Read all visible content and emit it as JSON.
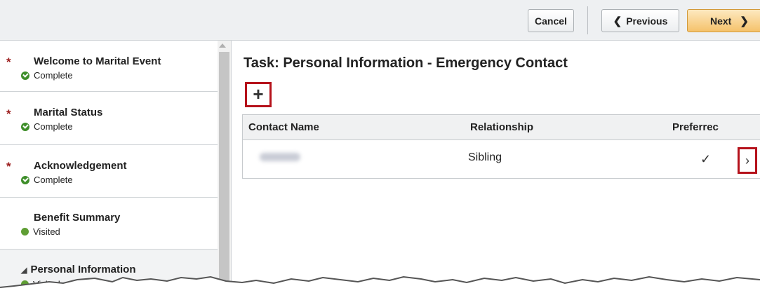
{
  "toolbar": {
    "cancel_label": "Cancel",
    "previous_label": "Previous",
    "previous_icon": "chevron-left-icon",
    "next_label": "Next",
    "next_icon": "chevron-right-icon",
    "next_accent": "#f5c26b"
  },
  "sidebar": {
    "steps": [
      {
        "title": "Welcome to Marital Event",
        "status": "Complete",
        "required": true,
        "status_icon": "check-circle-icon"
      },
      {
        "title": "Marital Status",
        "status": "Complete",
        "required": true,
        "status_icon": "check-circle-icon"
      },
      {
        "title": "Acknowledgement",
        "status": "Complete",
        "required": true,
        "status_icon": "check-circle-icon"
      },
      {
        "title": "Benefit Summary",
        "status": "Visited",
        "required": false,
        "status_icon": "green-dot-icon"
      },
      {
        "title": "Personal Information",
        "status": "Visited",
        "required": false,
        "status_icon": "green-dot-icon",
        "expanded": true
      }
    ],
    "required_marker": "*",
    "required_color": "#9b1c1c",
    "status_color": "#3e8e2a"
  },
  "main": {
    "title": "Task: Personal Information - Emergency Contact",
    "add_icon": "plus-icon",
    "highlight_color": "#b5121b",
    "grid": {
      "columns": [
        "Contact Name",
        "Relationship",
        "Preferrec"
      ],
      "rows": [
        {
          "relationship": "Sibling",
          "preferred": "✓",
          "nav_icon": "chevron-right-icon"
        }
      ]
    }
  }
}
